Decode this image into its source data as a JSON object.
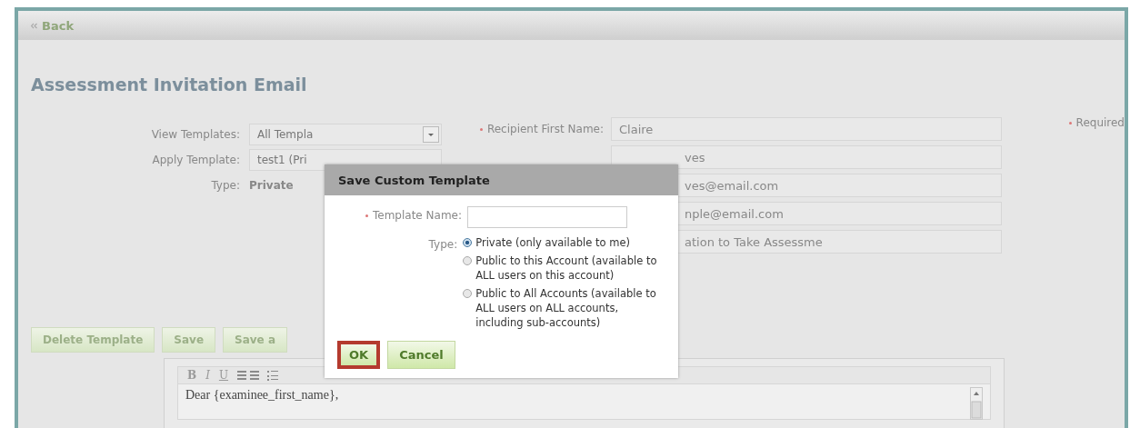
{
  "back_link": "Back",
  "page_title": "Assessment Invitation Email",
  "required_note": "Required",
  "left_fields": [
    {
      "label": "View Templates:",
      "kind": "select",
      "value": "All Templa"
    },
    {
      "label": "Apply Template:",
      "kind": "select",
      "value": "test1 (Pri"
    },
    {
      "label": "Type:",
      "kind": "static",
      "value": "Private"
    }
  ],
  "right_fields": [
    {
      "label": "Recipient First Name:",
      "value": "Claire"
    },
    {
      "value": "ves"
    },
    {
      "value": "ves@email.com"
    },
    {
      "value": "nple@email.com"
    },
    {
      "value": "ation to Take Assessme"
    }
  ],
  "actions": [
    "Delete Template",
    "Save",
    "Save a"
  ],
  "editor": {
    "toolbar": [
      "B",
      "I",
      "U"
    ],
    "body": "Dear {examinee_first_name},"
  },
  "dialog": {
    "title": "Save Custom Template",
    "name_label": "Template Name:",
    "type_label": "Type:",
    "options": [
      {
        "label": "Private (only available to me)",
        "selected": true
      },
      {
        "label": "Public to this Account (available to ALL users on this account)",
        "selected": false
      },
      {
        "label": "Public to All Accounts (available to ALL users on ALL accounts, including sub-accounts)",
        "selected": false
      }
    ],
    "buttons": [
      {
        "label": "OK",
        "highlighted": true
      },
      {
        "label": "Cancel",
        "highlighted": false
      }
    ]
  }
}
